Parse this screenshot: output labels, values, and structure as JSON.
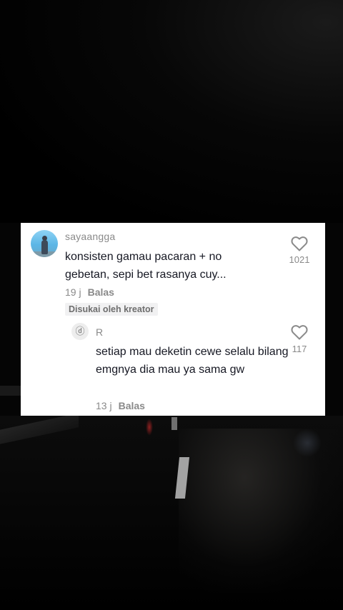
{
  "comment": {
    "username": "sayaangga",
    "text": "konsisten gamau pacaran + no gebetan, sepi bet rasanya cuy...",
    "time": "19 j",
    "reply_label": "Balas",
    "creator_badge": "Disukai oleh kreator",
    "likes": "1021"
  },
  "reply": {
    "avatar_glyph": "ⓓ",
    "username": "R",
    "text": "setiap mau deketin cewe selalu bilang emgnya dia mau ya sama gw",
    "time": "13 j",
    "reply_label": "Balas",
    "likes": "117"
  },
  "icons": {
    "like": "heart-outline-icon"
  },
  "colors": {
    "text_primary": "#161823",
    "text_secondary": "#8a8a8a",
    "card_bg": "#ffffff",
    "badge_bg": "#f1f1f2"
  }
}
